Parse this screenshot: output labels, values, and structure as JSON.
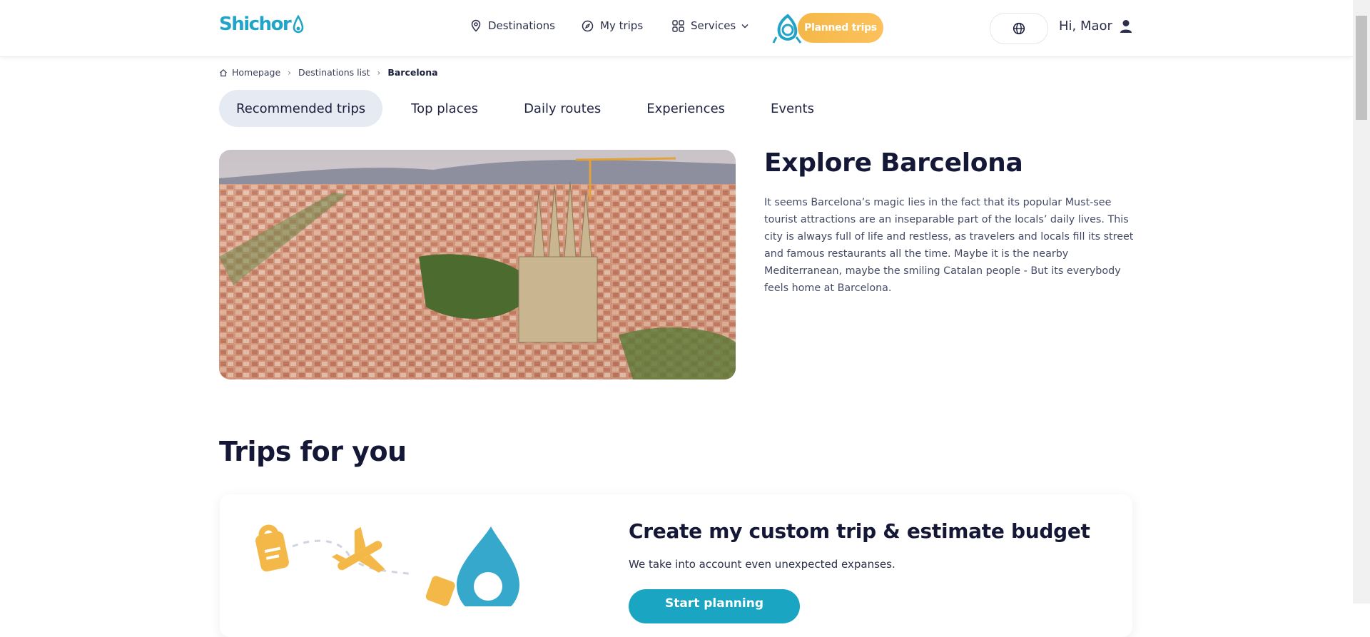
{
  "header": {
    "logo_text": "Shichor",
    "nav": [
      {
        "label": "Destinations",
        "icon": "location-pin-icon"
      },
      {
        "label": "My trips",
        "icon": "compass-icon"
      },
      {
        "label": "Services",
        "icon": "grid-icon"
      }
    ],
    "planned_trips_label": "Planned trips",
    "language_icon": "globe-icon",
    "greeting": "Hi, Maor",
    "user_icon": "user-icon",
    "brand_color": "#22a4c8",
    "accent_color": "#f4b848"
  },
  "breadcrumb": {
    "items": [
      "Homepage",
      "Destinations list",
      "Barcelona"
    ]
  },
  "tabs": [
    {
      "label": "Recommended trips",
      "active": true
    },
    {
      "label": "Top places",
      "active": false
    },
    {
      "label": "Daily routes",
      "active": false
    },
    {
      "label": "Experiences",
      "active": false
    },
    {
      "label": "Events",
      "active": false
    }
  ],
  "intro": {
    "title": "Explore Barcelona",
    "text": "It seems Barcelona’s magic lies in the fact that its popular Must-see tourist attractions are an inseparable part of the locals’ daily lives. This city is always full of life and restless, as travelers and locals fill its street and famous restaurants all the time. Maybe it is the nearby Mediterranean, maybe the smiling Catalan people - But its everybody feels home at Barcelona."
  },
  "trips_section": {
    "title": "Trips for you",
    "card": {
      "title": "Create my custom trip & estimate budget",
      "subtitle": "We take into account even unexpected expanses.",
      "button_label": "Start planning"
    }
  }
}
